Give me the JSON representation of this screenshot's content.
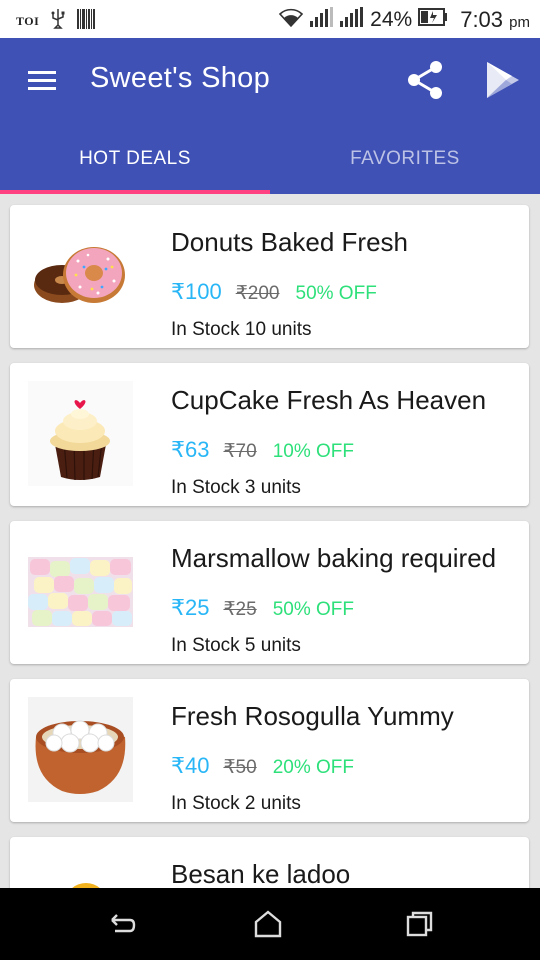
{
  "status_bar": {
    "left_text": "TOI",
    "battery": "24%",
    "time": "7:03",
    "ampm": "pm",
    "icons": [
      "toi-icon",
      "usb-icon",
      "barcode-icon",
      "wifi-icon",
      "signal-icon",
      "signal-icon",
      "battery-icon"
    ]
  },
  "app_bar": {
    "title": "Sweet's Shop",
    "menu_icon": "menu-icon",
    "share_icon": "share-icon",
    "play_icon": "play-store-icon",
    "color": "#3f51b5"
  },
  "tabs": [
    {
      "label": "HOT DEALS",
      "active": true
    },
    {
      "label": "FAVORITES",
      "active": false
    }
  ],
  "accent_color": "#ff4081",
  "price_color": "#29b6f6",
  "discount_color": "#2ee07a",
  "products": [
    {
      "title": "Donuts Baked Fresh",
      "price": "₹100",
      "old_price": "₹200",
      "discount": "50% OFF",
      "stock": "In Stock 10 units",
      "image": "donut-image"
    },
    {
      "title": "CupCake Fresh As Heaven",
      "price": "₹63",
      "old_price": "₹70",
      "discount": "10% OFF",
      "stock": "In Stock 3 units",
      "image": "cupcake-image"
    },
    {
      "title": "Marsmallow baking required",
      "price": "₹25",
      "old_price": "₹25",
      "discount": "50% OFF",
      "stock": "In Stock 5 units",
      "image": "marshmallow-image"
    },
    {
      "title": "Fresh Rosogulla Yummy",
      "price": "₹40",
      "old_price": "₹50",
      "discount": "20% OFF",
      "stock": "In Stock 2 units",
      "image": "rosogulla-image"
    },
    {
      "title": "Besan ke ladoo",
      "image": "ladoo-image"
    }
  ],
  "nav_bar": {
    "icons": [
      "back-icon",
      "home-icon",
      "recent-apps-icon"
    ]
  }
}
